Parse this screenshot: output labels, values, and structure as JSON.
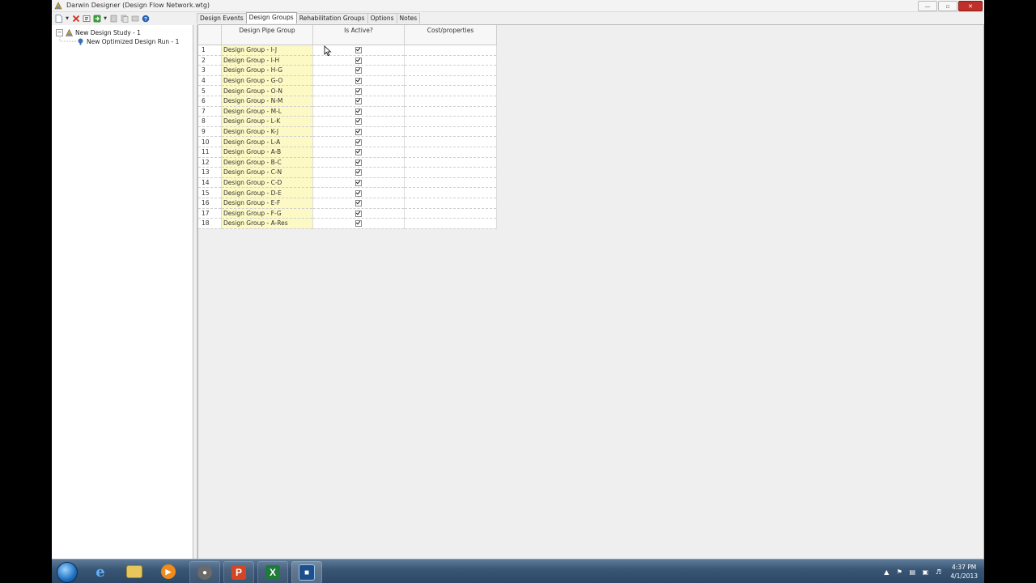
{
  "window": {
    "title": "Darwin Designer (Design Flow Network.wtg)"
  },
  "tabs": [
    {
      "label": "Design Events"
    },
    {
      "label": "Design Groups",
      "active": true
    },
    {
      "label": "Rehabilitation Groups"
    },
    {
      "label": "Options"
    },
    {
      "label": "Notes"
    }
  ],
  "tree": {
    "study": "New Design Study - 1",
    "run": "New Optimized Design Run - 1"
  },
  "grid": {
    "headers": [
      "Design Pipe Group",
      "Is Active?",
      "Cost/properties"
    ],
    "rows": [
      {
        "n": "1",
        "group": "Design Group - I-J",
        "active": true
      },
      {
        "n": "2",
        "group": "Design Group - I-H",
        "active": true
      },
      {
        "n": "3",
        "group": "Design Group - H-G",
        "active": true
      },
      {
        "n": "4",
        "group": "Design Group - G-O",
        "active": true
      },
      {
        "n": "5",
        "group": "Design Group - O-N",
        "active": true
      },
      {
        "n": "6",
        "group": "Design Group - N-M",
        "active": true
      },
      {
        "n": "7",
        "group": "Design Group - M-L",
        "active": true
      },
      {
        "n": "8",
        "group": "Design Group - L-K",
        "active": true
      },
      {
        "n": "9",
        "group": "Design Group - K-J",
        "active": true
      },
      {
        "n": "10",
        "group": "Design Group - L-A",
        "active": true
      },
      {
        "n": "11",
        "group": "Design Group - A-B",
        "active": true
      },
      {
        "n": "12",
        "group": "Design Group - B-C",
        "active": true
      },
      {
        "n": "13",
        "group": "Design Group - C-N",
        "active": true
      },
      {
        "n": "14",
        "group": "Design Group - C-D",
        "active": true
      },
      {
        "n": "15",
        "group": "Design Group - D-E",
        "active": true
      },
      {
        "n": "16",
        "group": "Design Group - E-F",
        "active": true
      },
      {
        "n": "17",
        "group": "Design Group - F-G",
        "active": true
      },
      {
        "n": "18",
        "group": "Design Group - A-Res",
        "active": true
      }
    ]
  },
  "taskbar": {
    "apps": [
      "start-orb",
      "internet-explorer-icon",
      "file-explorer-icon",
      "media-player-icon",
      "darwin-designer-icon",
      "powerpoint-icon",
      "excel-icon",
      "screen-recorder-icon"
    ]
  },
  "clock": {
    "time": "4:37 PM",
    "date": "4/1/2013"
  },
  "colors": {
    "group_cell": "#fdf9c4",
    "taskbar": "#3a5675"
  }
}
